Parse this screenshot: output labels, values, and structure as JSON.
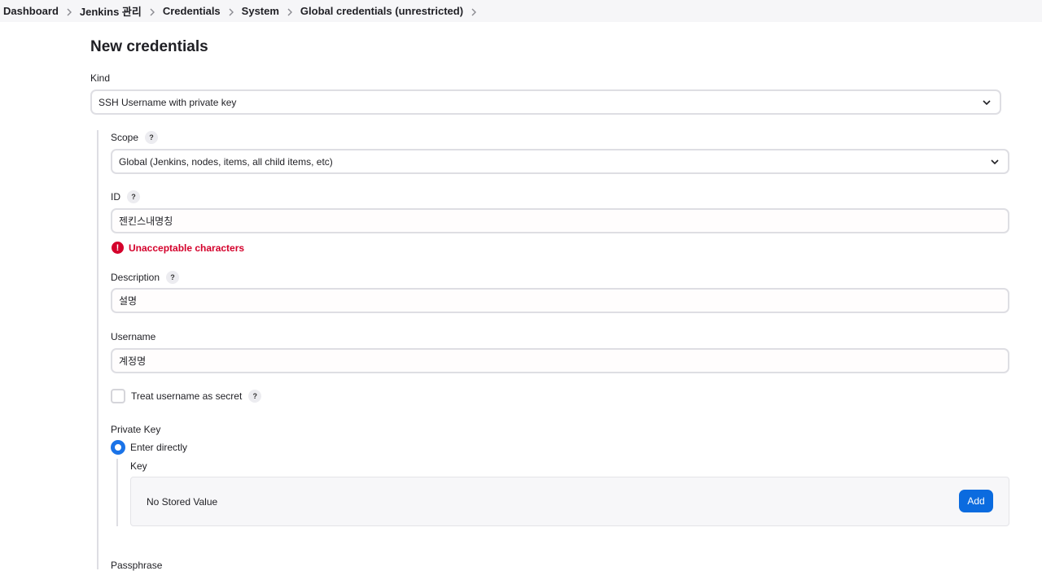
{
  "breadcrumb": [
    {
      "label": "Dashboard"
    },
    {
      "label": "Jenkins 관리"
    },
    {
      "label": "Credentials"
    },
    {
      "label": "System"
    },
    {
      "label": "Global credentials (unrestricted)"
    }
  ],
  "page": {
    "title": "New credentials"
  },
  "kind": {
    "label": "Kind",
    "value": "SSH Username with private key"
  },
  "scope": {
    "label": "Scope",
    "help": "?",
    "value": "Global (Jenkins, nodes, items, all child items, etc)"
  },
  "id_field": {
    "label": "ID",
    "help": "?",
    "value": "젠킨스내명칭",
    "error_icon": "!",
    "error": "Unacceptable characters"
  },
  "description": {
    "label": "Description",
    "help": "?",
    "value": "설명"
  },
  "username": {
    "label": "Username",
    "value": "계정명"
  },
  "treat_secret": {
    "label": "Treat username as secret",
    "help": "?",
    "checked": false
  },
  "private_key": {
    "label": "Private Key",
    "option_label": "Enter directly",
    "key_label": "Key",
    "stored_value": "No Stored Value",
    "add_label": "Add"
  },
  "passphrase": {
    "label": "Passphrase"
  },
  "colors": {
    "accent": "#0b6bdf",
    "error": "#d4002b",
    "breadcrumb_bg": "#f6f6f8"
  }
}
